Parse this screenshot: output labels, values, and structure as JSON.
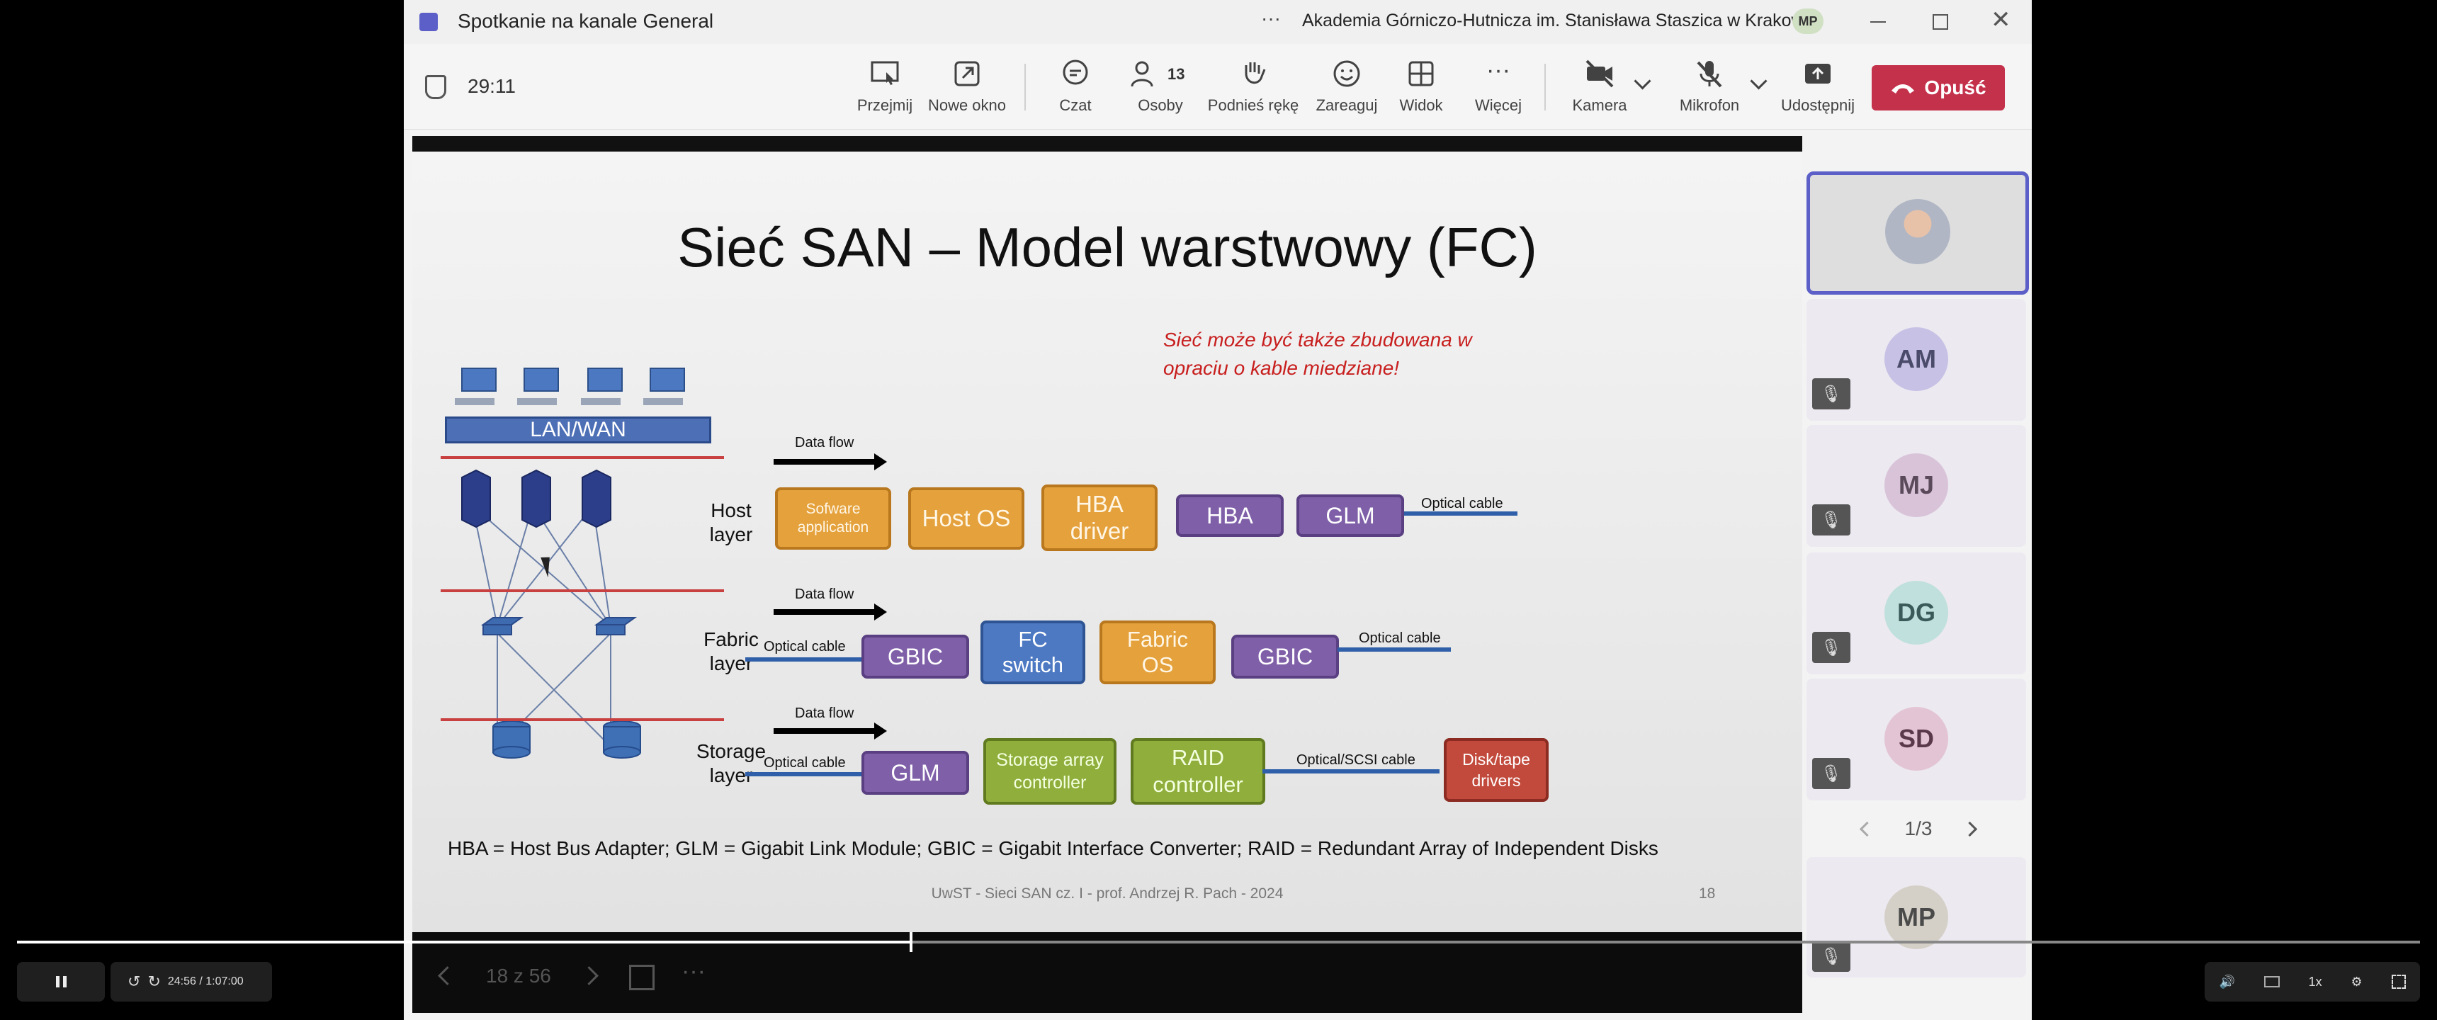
{
  "window": {
    "title": "Spotkanie na kanale General",
    "more_label": "···",
    "org_name": "Akademia Górniczo-Hutnicza im. Stanisława Staszica w Krakowie",
    "user_initials": "MP",
    "timer": "29:11"
  },
  "toolbar": {
    "przejmij": "Przejmij",
    "nowe_okno": "Nowe okno",
    "czat": "Czat",
    "osoby": "Osoby",
    "osoby_count": "13",
    "podnies_reke": "Podnieś rękę",
    "zareaguj": "Zareaguj",
    "widok": "Widok",
    "wiecej": "Więcej",
    "kamera": "Kamera",
    "mikrofon": "Mikrofon",
    "udostepnij": "Udostępnij",
    "opusc": "Opuść"
  },
  "slide": {
    "title": "Sieć SAN – Model warstwowy (FC)",
    "note_line1": "Sieć może być także zbudowana w",
    "note_line2": "opraciu o kable miedziane!",
    "lan_wan": "LAN/WAN",
    "data_flow": "Data flow",
    "host_layer": [
      "Host",
      "layer"
    ],
    "fabric_layer": [
      "Fabric",
      "layer"
    ],
    "storage_layer": [
      "Storage",
      "layer"
    ],
    "host_boxes": {
      "software_app": [
        "Sofware",
        "application"
      ],
      "host_os": "Host OS",
      "hba_driver": [
        "HBA",
        "driver"
      ],
      "hba": "HBA",
      "glm": "GLM"
    },
    "optical_cable": "Optical cable",
    "fabric_boxes": {
      "gbic1": "GBIC",
      "fc_switch": [
        "FC",
        "switch"
      ],
      "fabric_os": [
        "Fabric",
        "OS"
      ],
      "gbic2": "GBIC"
    },
    "storage_boxes": {
      "glm": "GLM",
      "storage_array": [
        "Storage array",
        "controller"
      ],
      "raid": [
        "RAID",
        "controller"
      ],
      "disk": [
        "Disk/tape",
        "drivers"
      ]
    },
    "optical_scsi_cable": "Optical/SCSI cable",
    "legend": "HBA = Host Bus Adapter; GLM = Gigabit Link Module; GBIC = Gigabit Interface Converter; RAID = Redundant Array of Independent Disks",
    "footer": "UwST - Sieci SAN cz. I - prof. Andrzej R. Pach - 2024",
    "page_number": "18"
  },
  "slide_nav": {
    "counter": "18 z 56",
    "more": "···"
  },
  "participants": {
    "tiles": [
      {
        "initials": "AM",
        "color": "#c8c1e6"
      },
      {
        "initials": "MJ",
        "color": "#d9c3d9"
      },
      {
        "initials": "DG",
        "color": "#bfe0dc"
      },
      {
        "initials": "SD",
        "color": "#e3c4d4"
      },
      {
        "initials": "MP",
        "color": "#d4d0c8"
      }
    ],
    "pager": "1/3"
  },
  "player": {
    "time": "24:56 / 1:07:00",
    "speed": "1x",
    "progress": 0.372
  }
}
